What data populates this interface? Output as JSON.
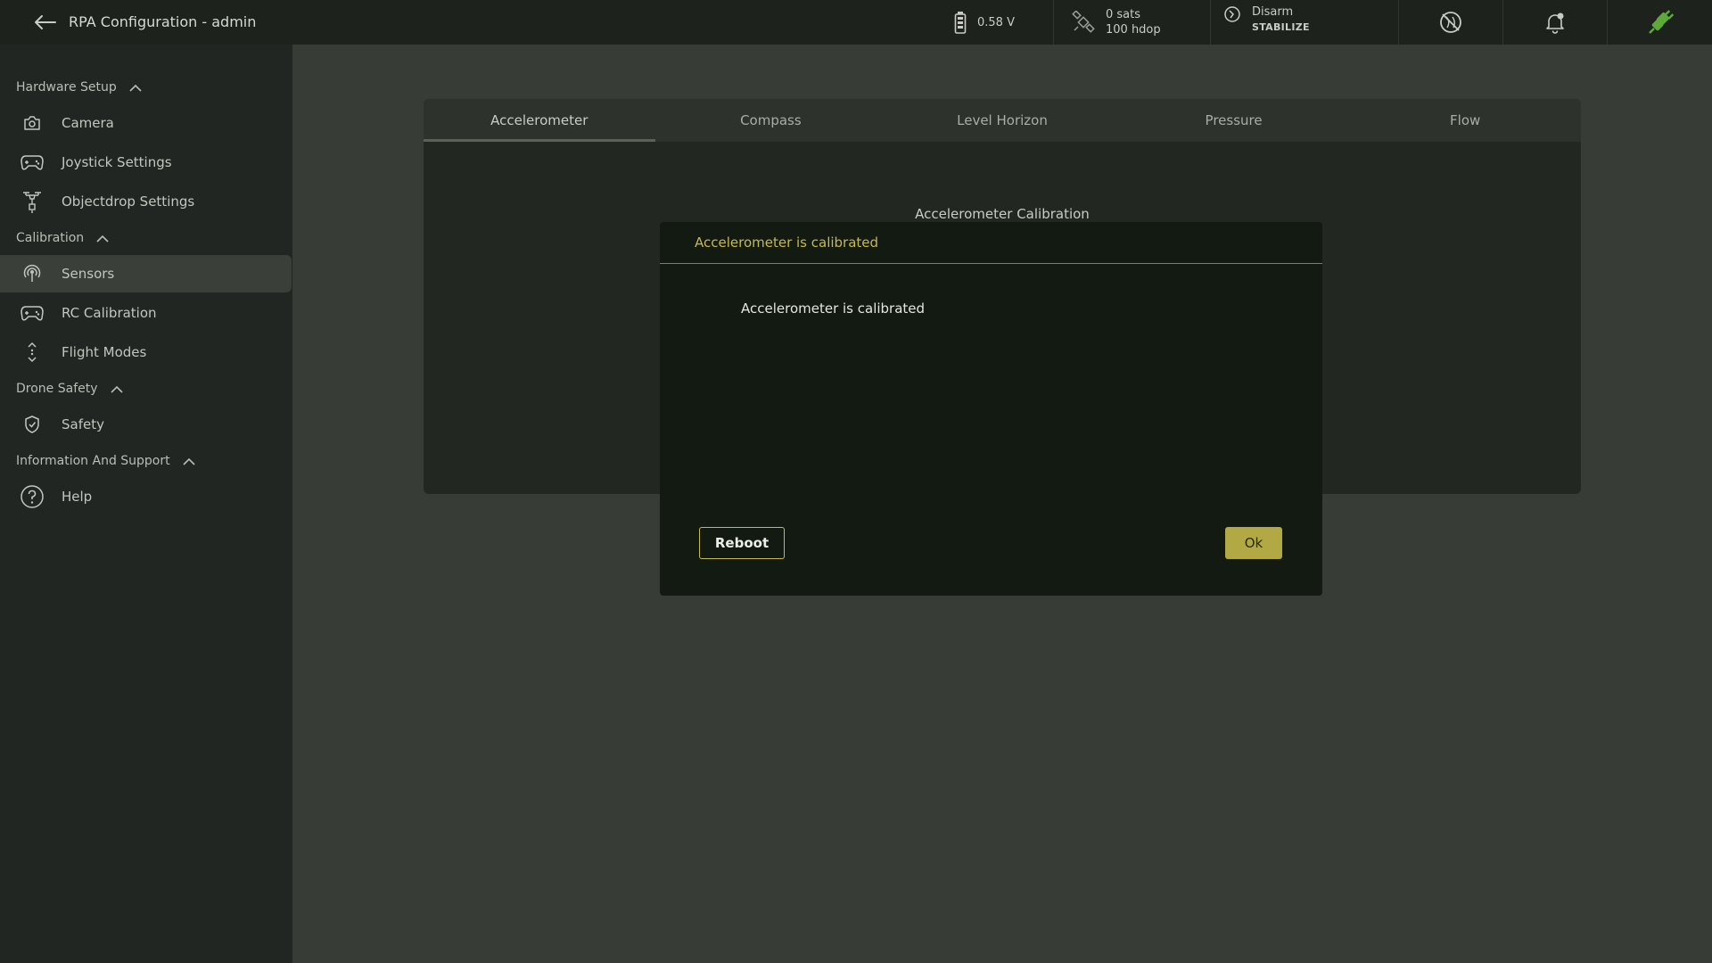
{
  "header": {
    "title": "RPA Configuration - admin",
    "battery": "0.58 V",
    "gps_sats": "0 sats",
    "gps_hdop": "100 hdop",
    "arm_state": "Disarm",
    "flight_mode": "STABILIZE",
    "icons": [
      "back-arrow-icon",
      "battery-icon",
      "satellite-icon",
      "arm-icon",
      "no-location-icon",
      "bell-icon",
      "plug-icon"
    ]
  },
  "sidebar": {
    "sections": [
      {
        "label": "Hardware Setup",
        "items": [
          {
            "label": "Camera",
            "icon": "camera-icon"
          },
          {
            "label": "Joystick Settings",
            "icon": "gamepad-icon"
          },
          {
            "label": "Objectdrop Settings",
            "icon": "drone-drop-icon"
          }
        ]
      },
      {
        "label": "Calibration",
        "items": [
          {
            "label": "Sensors",
            "icon": "sensor-icon",
            "active": true
          },
          {
            "label": "RC Calibration",
            "icon": "gamepad-icon"
          },
          {
            "label": "Flight Modes",
            "icon": "updown-icon"
          }
        ]
      },
      {
        "label": "Drone Safety",
        "items": [
          {
            "label": "Safety",
            "icon": "shield-icon"
          }
        ]
      },
      {
        "label": "Information And Support",
        "items": [
          {
            "label": "Help",
            "icon": "help-icon"
          }
        ]
      }
    ]
  },
  "main": {
    "tabs": [
      {
        "label": "Accelerometer",
        "active": true
      },
      {
        "label": "Compass"
      },
      {
        "label": "Level Horizon"
      },
      {
        "label": "Pressure"
      },
      {
        "label": "Flow"
      }
    ],
    "heading": "Accelerometer Calibration"
  },
  "dialog": {
    "title": "Accelerometer is calibrated",
    "message": "Accelerometer is calibrated",
    "reboot_label": "Reboot",
    "ok_label": "Ok"
  },
  "colors": {
    "accent": "#c4ba4e",
    "ok_button": "#b3a944",
    "connected": "#5fa83a"
  }
}
